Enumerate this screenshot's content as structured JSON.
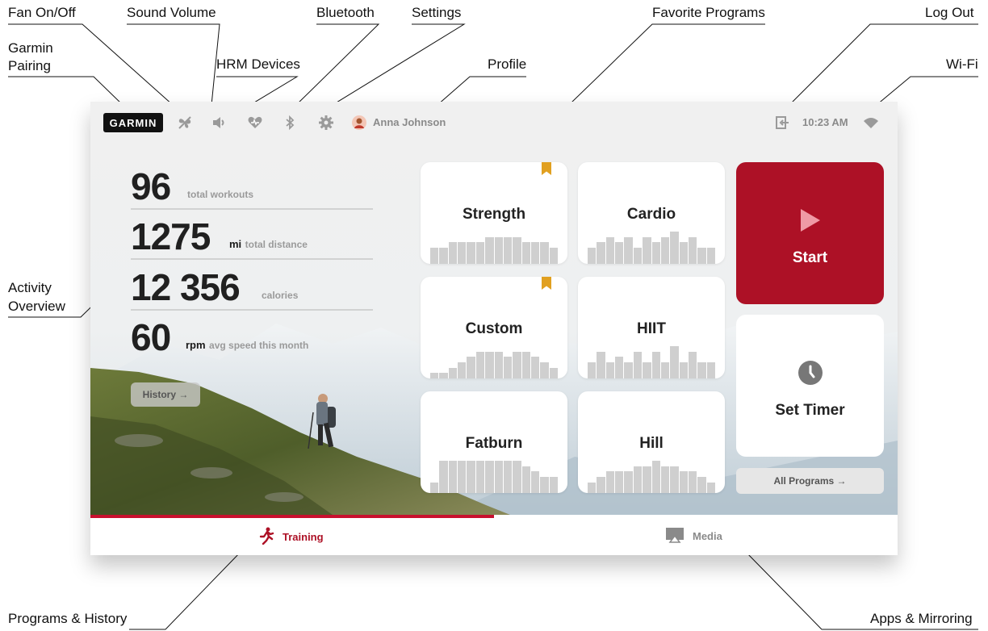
{
  "callouts": {
    "fan": "Fan On/Off",
    "sound": "Sound Volume",
    "bluetooth": "Bluetooth",
    "settings": "Settings",
    "favorites": "Favorite Programs",
    "logout": "Log Out",
    "garmin_l1": "Garmin",
    "garmin_l2": "Pairing",
    "hrm": "HRM Devices",
    "profile": "Profile",
    "wifi": "Wi-Fi",
    "activity_l1": "Activity",
    "activity_l2": "Overview",
    "programs_history": "Programs & History",
    "apps_mirroring": "Apps & Mirroring"
  },
  "topbar": {
    "logo": "GARMIN",
    "user_name": "Anna Johnson",
    "time": "10:23 AM",
    "icons": [
      "fan-off-icon",
      "speaker-icon",
      "heart-rate-icon",
      "bluetooth-icon",
      "gear-icon",
      "log-out-icon",
      "wifi-icon"
    ]
  },
  "stats": [
    {
      "value": "96",
      "unit": "",
      "label": "total workouts"
    },
    {
      "value": "1275",
      "unit": "mi",
      "label": "total distance"
    },
    {
      "value": "12 356",
      "unit": "",
      "label": "calories"
    },
    {
      "value": "60",
      "unit": "rpm",
      "label": "avg speed this month"
    }
  ],
  "history_button": "History →",
  "programs": [
    {
      "name": "Strength",
      "favorite": true,
      "profile": [
        3,
        3,
        4,
        4,
        4,
        4,
        5,
        5,
        5,
        5,
        4,
        4,
        4,
        3
      ]
    },
    {
      "name": "Cardio",
      "favorite": false,
      "profile": [
        3,
        4,
        5,
        4,
        5,
        3,
        5,
        4,
        5,
        6,
        4,
        5,
        3,
        3
      ]
    },
    {
      "name": "Custom",
      "favorite": true,
      "profile": [
        1,
        1,
        2,
        3,
        4,
        5,
        5,
        5,
        4,
        5,
        5,
        4,
        3,
        2
      ]
    },
    {
      "name": "HIIT",
      "favorite": false,
      "profile": [
        3,
        5,
        3,
        4,
        3,
        5,
        3,
        5,
        3,
        6,
        3,
        5,
        3,
        3
      ]
    },
    {
      "name": "Fatburn",
      "favorite": false,
      "profile": [
        2,
        6,
        6,
        6,
        6,
        6,
        6,
        6,
        6,
        6,
        5,
        4,
        3,
        3
      ]
    },
    {
      "name": "Hill",
      "favorite": false,
      "profile": [
        2,
        3,
        4,
        4,
        4,
        5,
        5,
        6,
        5,
        5,
        4,
        4,
        3,
        2
      ]
    }
  ],
  "start_label": "Start",
  "timer_label": "Set Timer",
  "all_programs": "All Programs →",
  "nav": {
    "training": "Training",
    "media": "Media"
  },
  "colors": {
    "accent": "#ad1126",
    "bookmark": "#e1a020",
    "bar": "#cfcfcf"
  }
}
